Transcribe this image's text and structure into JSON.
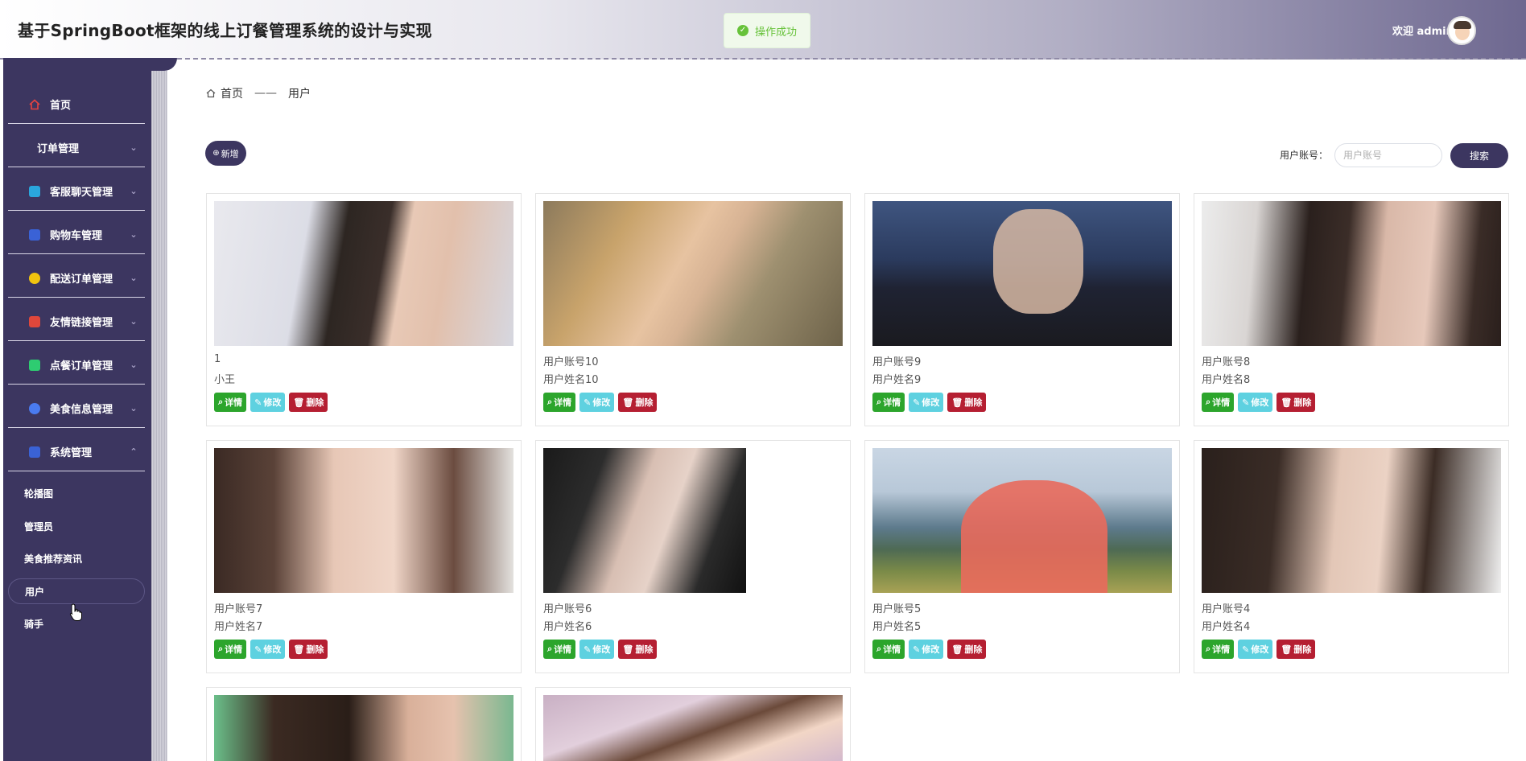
{
  "header": {
    "title": "基于SpringBoot框架的线上订餐管理系统的设计与实现",
    "toast": "操作成功",
    "welcome": "欢迎 admin"
  },
  "sidebar": {
    "menu": [
      {
        "label": "首页",
        "icon": "home-icon",
        "color": "#e64340",
        "has_chevron": false
      },
      {
        "label": "订单管理",
        "icon": "",
        "color": "",
        "has_chevron": true
      },
      {
        "label": "客服聊天管理",
        "icon": "chat-icon",
        "color": "#2aa6dc",
        "has_chevron": true
      },
      {
        "label": "购物车管理",
        "icon": "cart-icon",
        "color": "#3a62d6",
        "has_chevron": true
      },
      {
        "label": "配送订单管理",
        "icon": "delivery-icon",
        "color": "#f1c40f",
        "has_chevron": true
      },
      {
        "label": "友情链接管理",
        "icon": "link-icon",
        "color": "#e0473b",
        "has_chevron": true
      },
      {
        "label": "点餐订单管理",
        "icon": "order-icon",
        "color": "#2ecc71",
        "has_chevron": true
      },
      {
        "label": "美食信息管理",
        "icon": "food-icon",
        "color": "#4a7bf0",
        "has_chevron": true
      },
      {
        "label": "系统管理",
        "icon": "settings-icon",
        "color": "#3a62d6",
        "has_chevron": true,
        "expanded": true
      }
    ],
    "submenu": [
      {
        "label": "轮播图",
        "active": false
      },
      {
        "label": "管理员",
        "active": false
      },
      {
        "label": "美食推荐资讯",
        "active": false
      },
      {
        "label": "用户",
        "active": true
      },
      {
        "label": "骑手",
        "active": false
      }
    ]
  },
  "breadcrumb": {
    "home": "首页",
    "separator": "——",
    "current": "用户"
  },
  "toolbar": {
    "add_label": "新增",
    "search_label": "用户账号：",
    "search_placeholder": "用户账号",
    "search_button": "搜索"
  },
  "actions": {
    "detail": "详情",
    "edit": "修改",
    "delete": "删除"
  },
  "cards": [
    {
      "line1": "1",
      "line2": "小王"
    },
    {
      "line1": "用户账号10",
      "line2": "用户姓名10"
    },
    {
      "line1": "用户账号9",
      "line2": "用户姓名9"
    },
    {
      "line1": "用户账号8",
      "line2": "用户姓名8"
    },
    {
      "line1": "用户账号7",
      "line2": "用户姓名7"
    },
    {
      "line1": "用户账号6",
      "line2": "用户姓名6"
    },
    {
      "line1": "用户账号5",
      "line2": "用户姓名5"
    },
    {
      "line1": "用户账号4",
      "line2": "用户姓名4"
    },
    {
      "line1": "",
      "line2": ""
    },
    {
      "line1": "",
      "line2": ""
    }
  ]
}
